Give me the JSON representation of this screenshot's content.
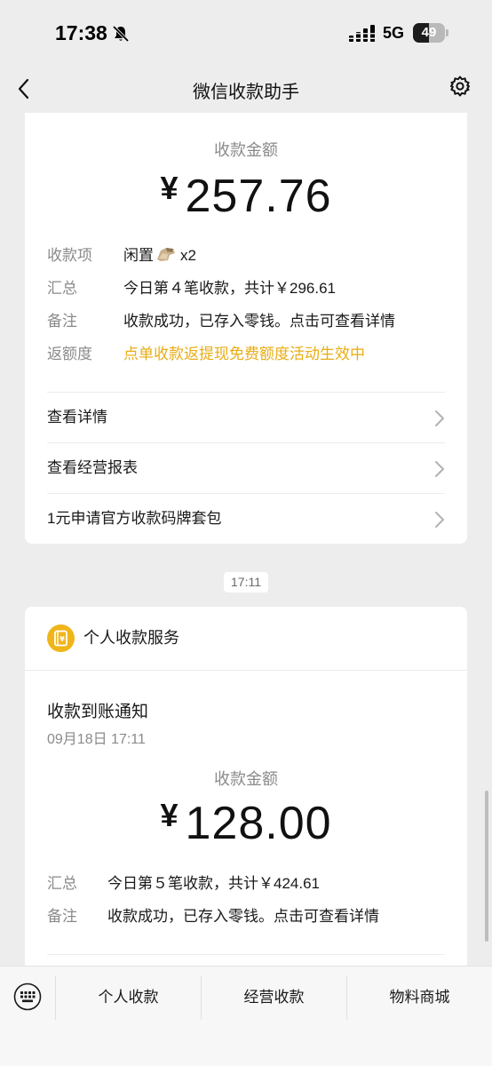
{
  "status_bar": {
    "time": "17:38",
    "network": "5G",
    "battery": "49",
    "battery_level": 0.49,
    "icons": [
      "bell-slash-icon",
      "signal-icon"
    ]
  },
  "nav": {
    "title": "微信收款助手",
    "icons": [
      "back-icon",
      "gear-icon"
    ]
  },
  "receipt_1": {
    "amount_label": "收款金额",
    "currency": "¥",
    "amount": "257.76",
    "details": [
      {
        "key": "收款项",
        "value": "闲置",
        "suffix": "x2",
        "icon": "item-thumbnail-icon"
      },
      {
        "key": "汇总",
        "value": "今日第４笔收款，共计￥296.61"
      },
      {
        "key": "备注",
        "value": "收款成功，已存入零钱。点击可查看详情"
      },
      {
        "key": "返额度",
        "value": "点单收款返提现免费额度活动生效中",
        "highlight": "#e8ad14"
      }
    ],
    "links": [
      "查看详情",
      "查看经营报表",
      "1元申请官方收款码牌套包"
    ]
  },
  "timestamp": "17:11",
  "receipt_2": {
    "service_title": "个人收款服务",
    "service_icon": "wallet-yen-icon",
    "notice_title": "收款到账通知",
    "notice_date": "09月18日 17:11",
    "amount_label": "收款金额",
    "currency": "¥",
    "amount": "128.00",
    "details": [
      {
        "key": "汇总",
        "value": "今日第５笔收款，共计￥424.61"
      },
      {
        "key": "备注",
        "value": "收款成功，已存入零钱。点击可查看详情"
      }
    ]
  },
  "bottom_menu": {
    "items": [
      "个人收款",
      "经营收款",
      "物料商城"
    ],
    "icons": [
      "keyboard-icon"
    ]
  },
  "colors": {
    "background": "#ededed",
    "card": "#ffffff",
    "accent_yellow": "#e8ad14",
    "secondary_text": "#8a8a8a"
  }
}
